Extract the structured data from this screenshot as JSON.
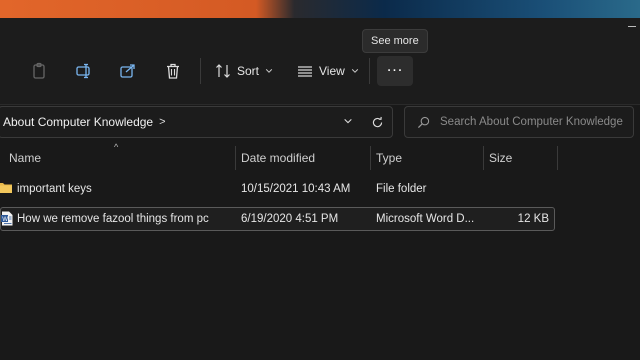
{
  "toolbar": {
    "sort_label": "Sort",
    "view_label": "View",
    "more_label": "...",
    "tooltip": "See more",
    "icons": [
      "paste-icon",
      "rename-icon",
      "share-icon",
      "delete-icon",
      "sort-icon",
      "view-icon",
      "chevron-down-icon"
    ]
  },
  "address_bar": {
    "crumbs": [
      "About Computer Knowledge"
    ],
    "separator": ">"
  },
  "search": {
    "placeholder": "Search About Computer Knowledge"
  },
  "columns": {
    "name": "Name",
    "date_modified": "Date modified",
    "type": "Type",
    "size": "Size"
  },
  "files": [
    {
      "name": "important keys",
      "date_modified": "10/15/2021 10:43 AM",
      "type": "File folder",
      "size": "",
      "icon": "folder-icon",
      "selected": false
    },
    {
      "name": "How we remove fazool things from pc",
      "date_modified": "6/19/2020 4:51 PM",
      "type": "Microsoft Word D...",
      "size": "12 KB",
      "icon": "word-document-icon",
      "selected": true
    }
  ],
  "colors": {
    "background": "#1c1c1c",
    "folder": "#e8b84a",
    "accent_border": "#5a5a5a"
  }
}
